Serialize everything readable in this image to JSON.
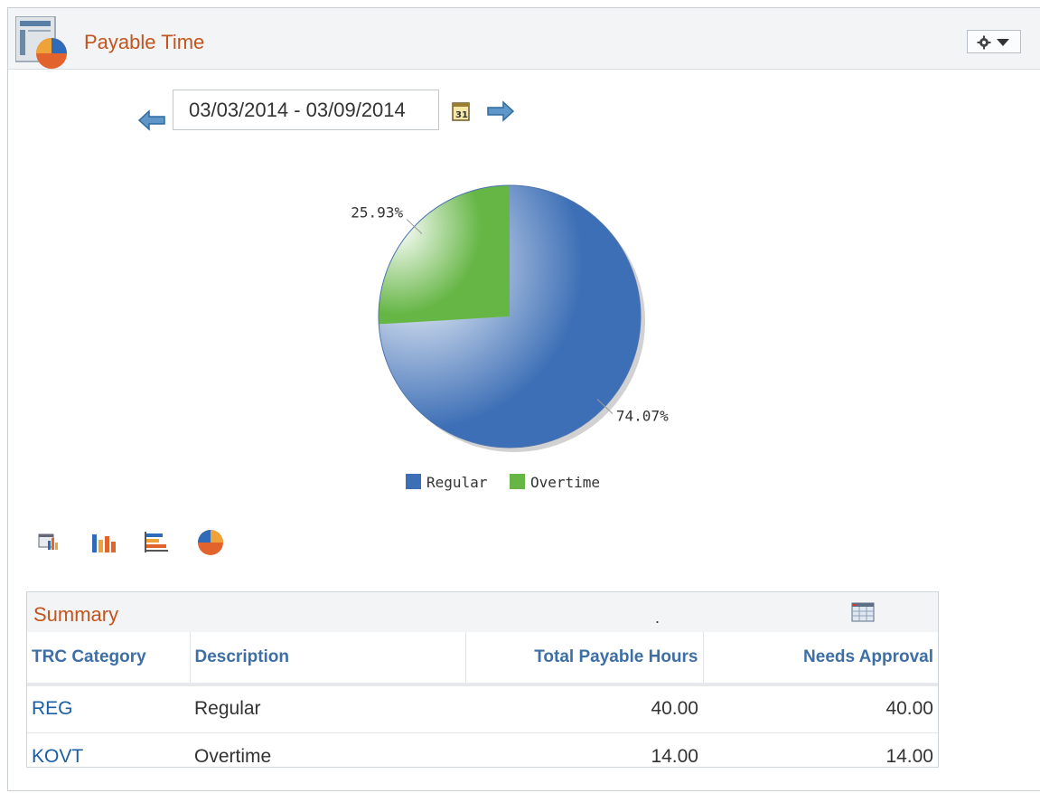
{
  "pagelet": {
    "title": "Payable Time"
  },
  "icons": {
    "header": "pie-chart-pagelet-icon",
    "menu": "gear-icon",
    "menu_caret": "chevron-down-icon",
    "prev": "arrow-left-icon",
    "next": "arrow-right-icon",
    "calendar": "calendar-icon",
    "grid_options": "grid-icon",
    "chart_types": [
      "table-chart-icon",
      "bar-chart-icon",
      "horizontal-bar-chart-icon",
      "pie-chart-icon"
    ]
  },
  "date_range": {
    "value": "03/03/2014 - 03/09/2014"
  },
  "chart_data": {
    "type": "pie",
    "title": "",
    "slices": [
      {
        "name": "Regular",
        "value": 74.07,
        "label": "74.07%",
        "color": "#3d6fb6"
      },
      {
        "name": "Overtime",
        "value": 25.93,
        "label": "25.93%",
        "color": "#66b646"
      }
    ],
    "legend": {
      "position": "bottom",
      "entries": [
        "Regular",
        "Overtime"
      ]
    }
  },
  "summary": {
    "title": "Summary",
    "dot": ".",
    "columns": [
      "TRC Category",
      "Description",
      "Total Payable Hours",
      "Needs Approval"
    ],
    "rows": [
      {
        "trc": "REG",
        "description": "Regular",
        "total": "40.00",
        "approval": "40.00"
      },
      {
        "trc": "KOVT",
        "description": "Overtime",
        "total": "14.00",
        "approval": "14.00"
      }
    ]
  },
  "colors": {
    "accent": "#c2541d",
    "link": "#1a5ea6",
    "header_link": "#3d6fa6"
  }
}
